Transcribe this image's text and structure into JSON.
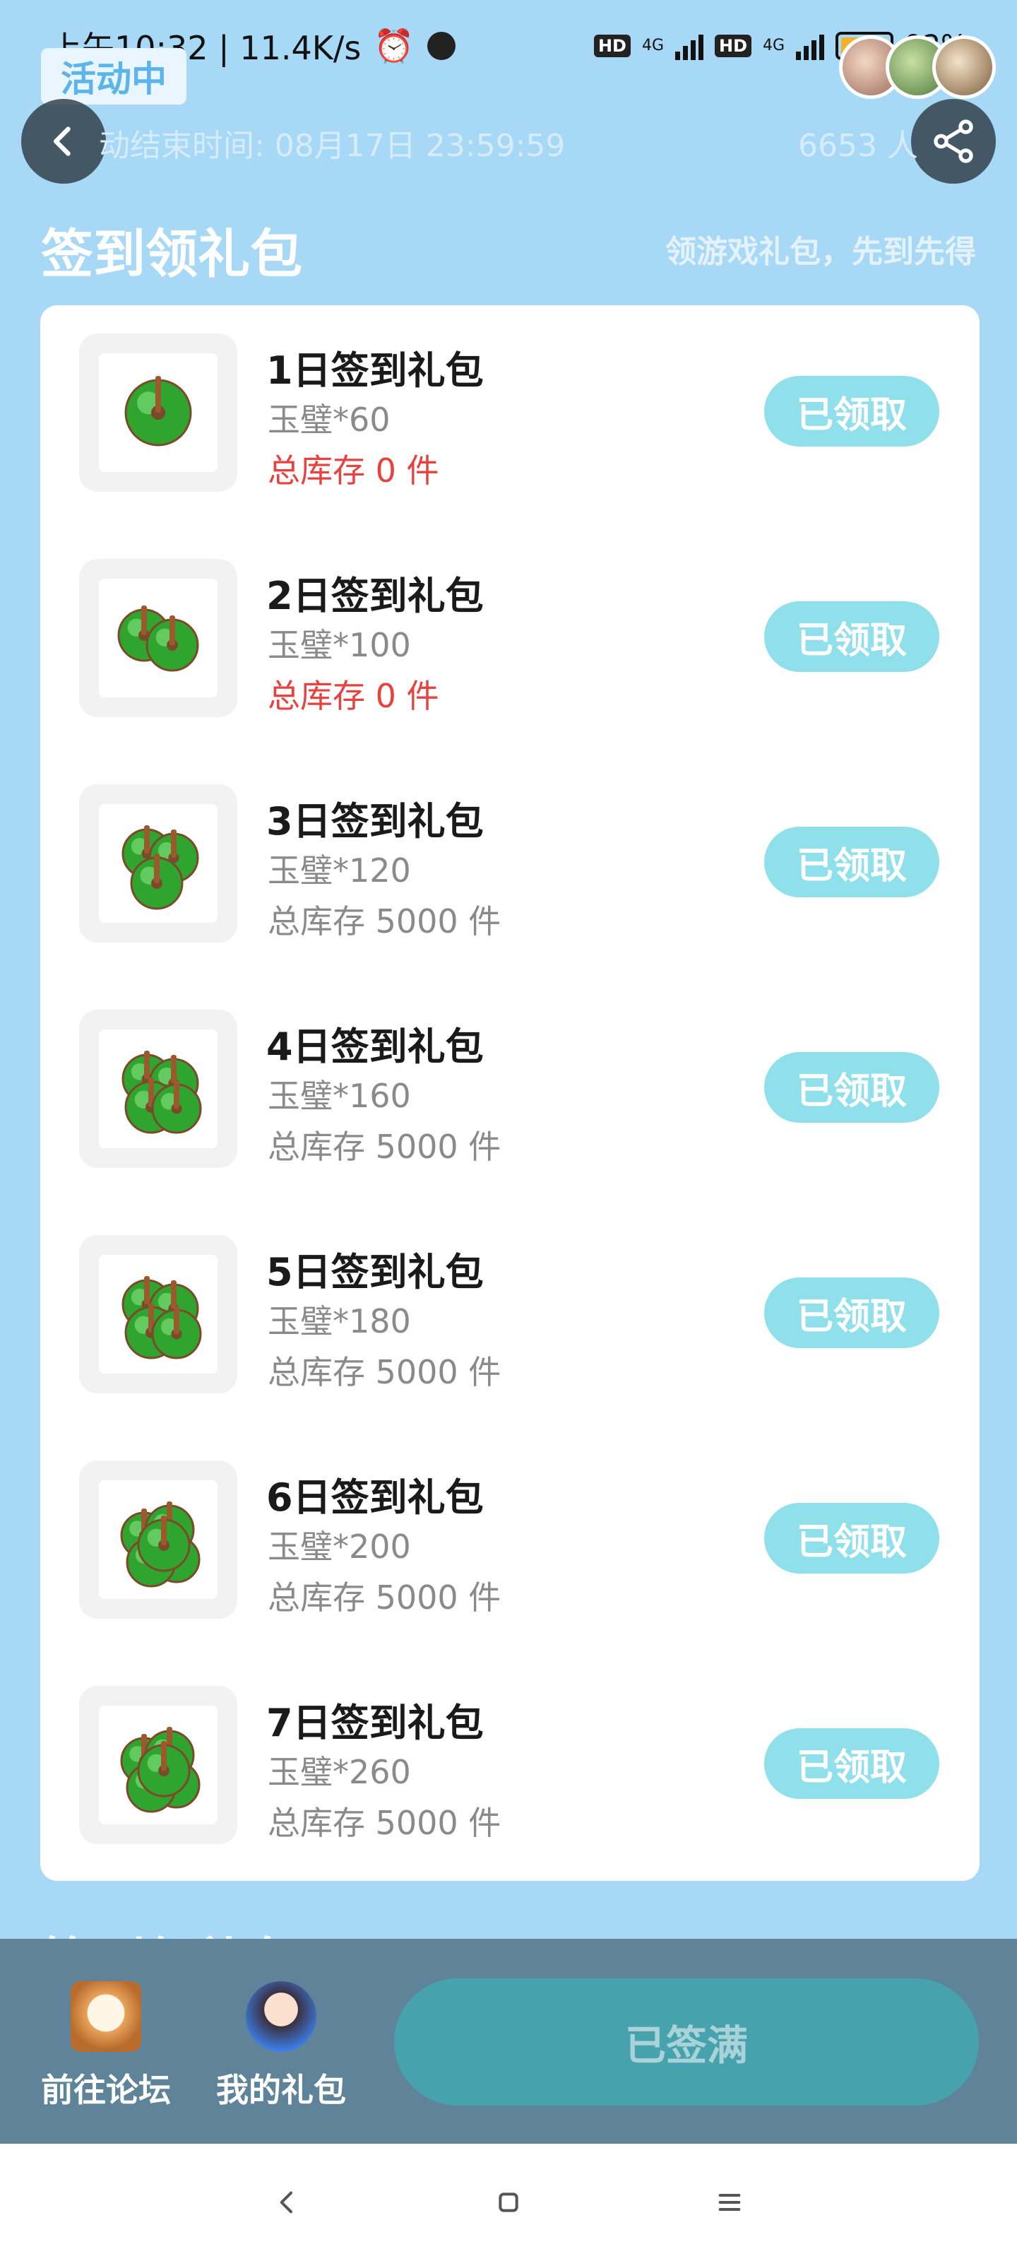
{
  "status_bar": {
    "time_speed": "上午10:32 | 11.4K/s",
    "network_label": "4G",
    "hd_label": "HD",
    "battery": "92%"
  },
  "header": {
    "badge": "活动中",
    "end_time": "动结束时间: 08月17日 23:59:59",
    "participants": "6653 人"
  },
  "section": {
    "title": "签到领礼包",
    "subtitle": "领游戏礼包，先到先得"
  },
  "gifts": [
    {
      "name": "1日签到礼包",
      "desc": "玉璧*60",
      "stock": "总库存 0 件",
      "stock_empty": true,
      "button": "已领取",
      "coins": 1
    },
    {
      "name": "2日签到礼包",
      "desc": "玉璧*100",
      "stock": "总库存 0 件",
      "stock_empty": true,
      "button": "已领取",
      "coins": 2
    },
    {
      "name": "3日签到礼包",
      "desc": "玉璧*120",
      "stock": "总库存 5000 件",
      "stock_empty": false,
      "button": "已领取",
      "coins": 3
    },
    {
      "name": "4日签到礼包",
      "desc": "玉璧*160",
      "stock": "总库存 5000 件",
      "stock_empty": false,
      "button": "已领取",
      "coins": 4
    },
    {
      "name": "5日签到礼包",
      "desc": "玉璧*180",
      "stock": "总库存 5000 件",
      "stock_empty": false,
      "button": "已领取",
      "coins": 4
    },
    {
      "name": "6日签到礼包",
      "desc": "玉璧*200",
      "stock": "总库存 5000 件",
      "stock_empty": false,
      "button": "已领取",
      "coins": 5
    },
    {
      "name": "7日签到礼包",
      "desc": "玉璧*260",
      "stock": "总库存 5000 件",
      "stock_empty": false,
      "button": "已领取",
      "coins": 5
    }
  ],
  "bottom_bar": {
    "forum_label": "前往论坛",
    "my_gifts_label": "我的礼包",
    "signin_label": "已签满"
  },
  "colors": {
    "page_bg": "#a7d8f6",
    "claim_button": "#8fe0ea",
    "stock_empty": "#e8423e",
    "bottom_bar": "#5f8399",
    "signin_button": "#46a3ad"
  },
  "icons": {
    "back": "chevron-left-icon",
    "share": "share-icon",
    "alarm": "alarm-icon",
    "coin": "jade-coin-icon"
  }
}
